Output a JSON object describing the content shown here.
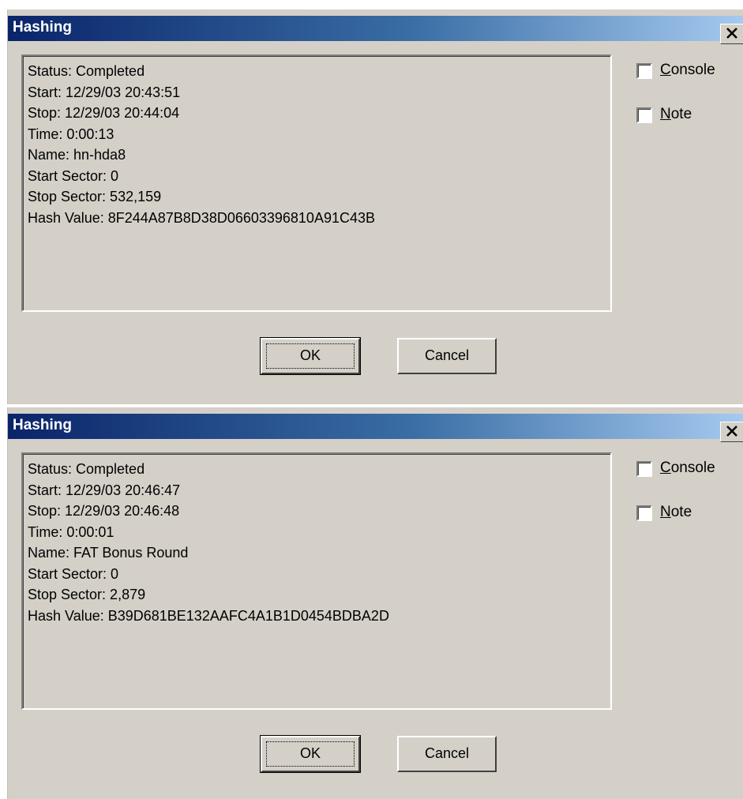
{
  "dialogs": [
    {
      "title": "Hashing",
      "status_lines": [
        "Status: Completed",
        "Start: 12/29/03 20:43:51",
        "Stop: 12/29/03 20:44:04",
        "Time: 0:00:13",
        "Name: hn-hda8",
        "Start Sector: 0",
        "Stop Sector: 532,159",
        "Hash Value: 8F244A87B8D38D06603396810A91C43B"
      ],
      "console": {
        "accel": "C",
        "rest": "onsole",
        "checked": false
      },
      "note": {
        "accel": "N",
        "rest": "ote",
        "checked": false
      },
      "ok_label": "OK",
      "cancel_label": "Cancel"
    },
    {
      "title": "Hashing",
      "status_lines": [
        "Status: Completed",
        "Start: 12/29/03 20:46:47",
        "Stop: 12/29/03 20:46:48",
        "Time: 0:00:01",
        "Name: FAT Bonus Round",
        "Start Sector: 0",
        "Stop Sector: 2,879",
        "Hash Value: B39D681BE132AAFC4A1B1D0454BDBA2D"
      ],
      "console": {
        "accel": "C",
        "rest": "onsole",
        "checked": false
      },
      "note": {
        "accel": "N",
        "rest": "ote",
        "checked": false
      },
      "ok_label": "OK",
      "cancel_label": "Cancel"
    }
  ],
  "icons": {
    "close": "close-icon"
  },
  "colors": {
    "dialog_bg": "#d4d0c8",
    "title_start": "#0a246a",
    "title_end": "#a6caf0"
  }
}
